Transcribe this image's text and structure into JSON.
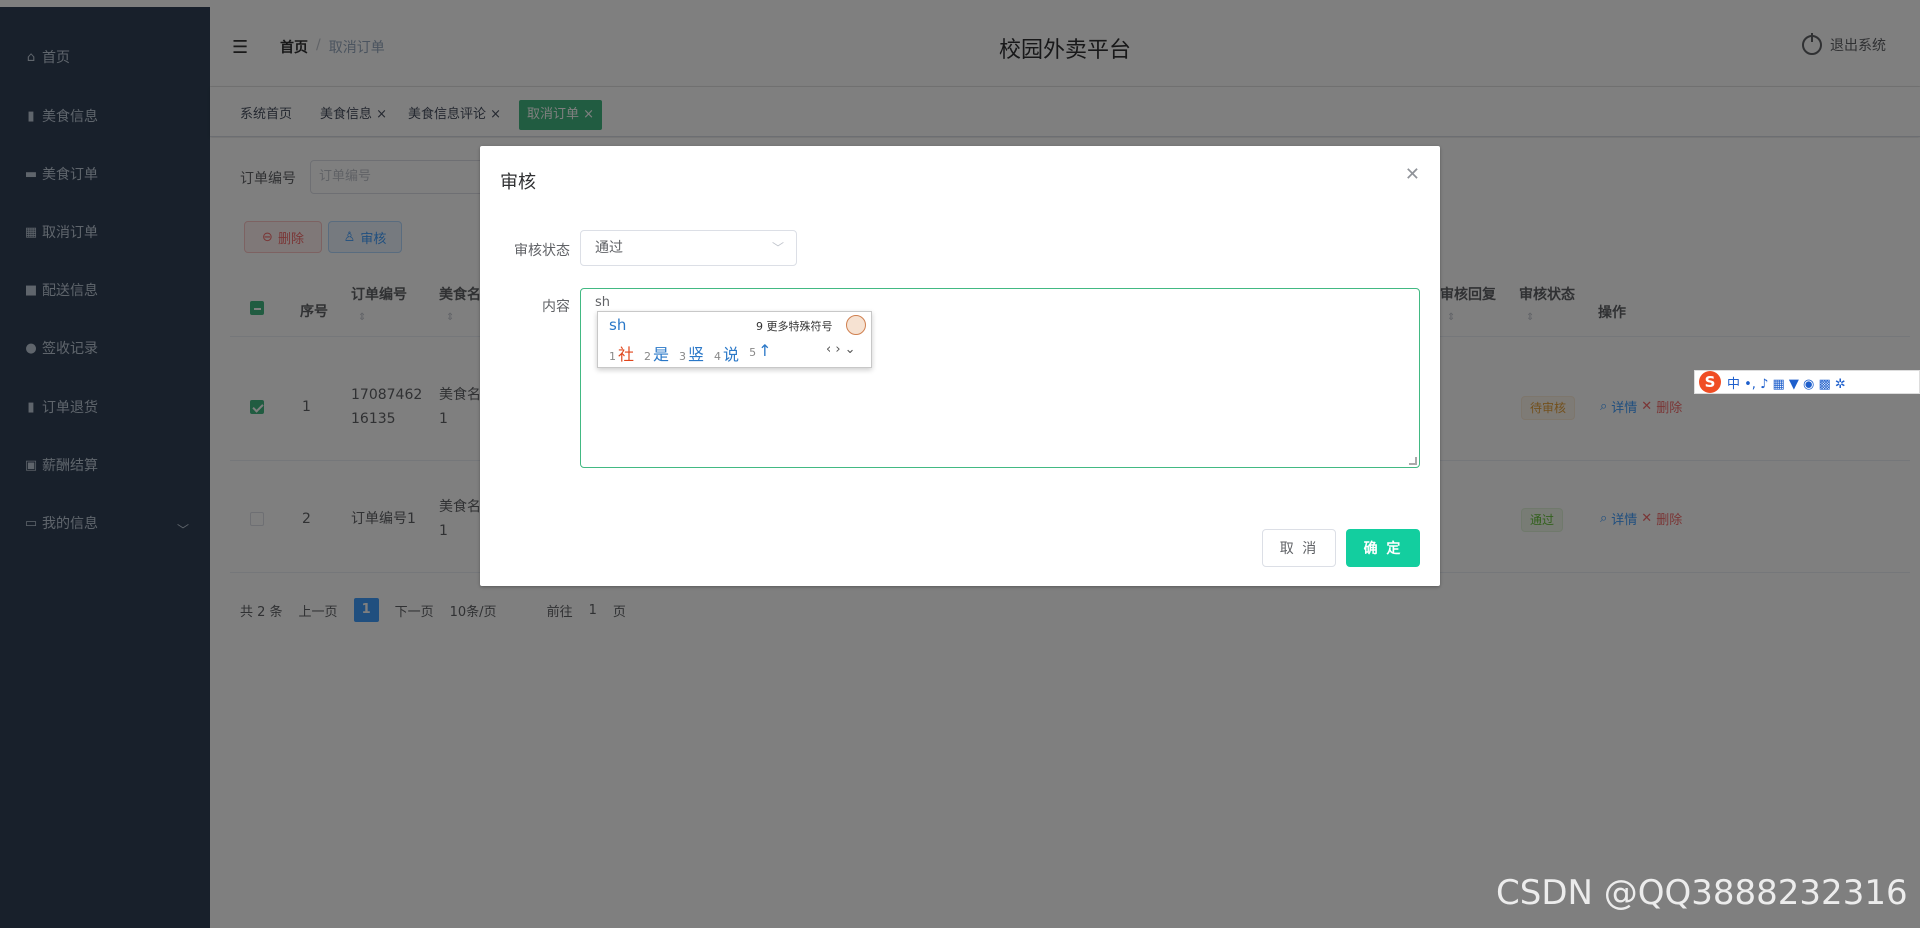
{
  "sidebar": {
    "items": [
      {
        "label": "首页",
        "icon": "home-icon",
        "glyph": "⌂"
      },
      {
        "label": "美食信息",
        "icon": "chart-icon",
        "glyph": "▮"
      },
      {
        "label": "美食订单",
        "icon": "car-icon",
        "glyph": "▬"
      },
      {
        "label": "取消订单",
        "icon": "grid-icon",
        "glyph": "▦"
      },
      {
        "label": "配送信息",
        "icon": "message-icon",
        "glyph": "■"
      },
      {
        "label": "签收记录",
        "icon": "user-icon",
        "glyph": "●"
      },
      {
        "label": "订单退货",
        "icon": "bar-chart-icon",
        "glyph": "▮"
      },
      {
        "label": "薪酬结算",
        "icon": "document-icon",
        "glyph": "▣"
      },
      {
        "label": "我的信息",
        "icon": "wallet-icon",
        "glyph": "▭"
      }
    ],
    "expand_glyph": "﹀"
  },
  "header": {
    "breadcrumb_home": "首页",
    "breadcrumb_sep": "/",
    "breadcrumb_current": "取消订单",
    "title": "校园外卖平台",
    "logout": "退出系统"
  },
  "tabs": [
    "系统首页",
    "美食信息 ×",
    "美食信息评论 ×",
    "取消订单 ×"
  ],
  "search": {
    "label": "订单编号",
    "placeholder": "订单编号"
  },
  "toolbar": {
    "delete_label": "删除",
    "audit_label": "审核"
  },
  "table": {
    "headers": [
      "序号",
      "订单编号",
      "美食名",
      "审核回复",
      "审核状态",
      "操作"
    ],
    "rows": [
      {
        "index": "1",
        "order_no_l1": "17087462",
        "order_no_l2": "16135",
        "food_l1": "美食名",
        "food_l2": "1",
        "status": "待审核",
        "checked": true
      },
      {
        "index": "2",
        "order_no_l1": "订单编号1",
        "order_no_l2": "",
        "food_l1": "美食名",
        "food_l2": "1",
        "status": "通过",
        "checked": false
      }
    ],
    "op_detail": "详情",
    "op_delete": "删除"
  },
  "pager": {
    "total": "共 2 条",
    "prev": "上一页",
    "page": "1",
    "next": "下一页",
    "size": "10条/页",
    "goto": "前往",
    "goto_val": "1",
    "page_unit": "页"
  },
  "dialog": {
    "title": "审核",
    "status_label": "审核状态",
    "status_value": "通过",
    "content_label": "内容",
    "content_value": "sh",
    "cancel": "取 消",
    "confirm": "确 定"
  },
  "ime": {
    "input": "sh",
    "more": "9 更多特殊符号",
    "candidates": [
      {
        "num": "1",
        "text": "社"
      },
      {
        "num": "2",
        "text": "是"
      },
      {
        "num": "3",
        "text": "竖"
      },
      {
        "num": "4",
        "text": "说"
      },
      {
        "num": "5",
        "text": "↑"
      }
    ],
    "nav": "‹ › ⌄"
  },
  "sogou_toolbar": {
    "logo": "S",
    "items": "中 •, ♪ ▦ ▼ ◉ ▩ ✲"
  },
  "watermark": "CSDN @QQ3888232316"
}
